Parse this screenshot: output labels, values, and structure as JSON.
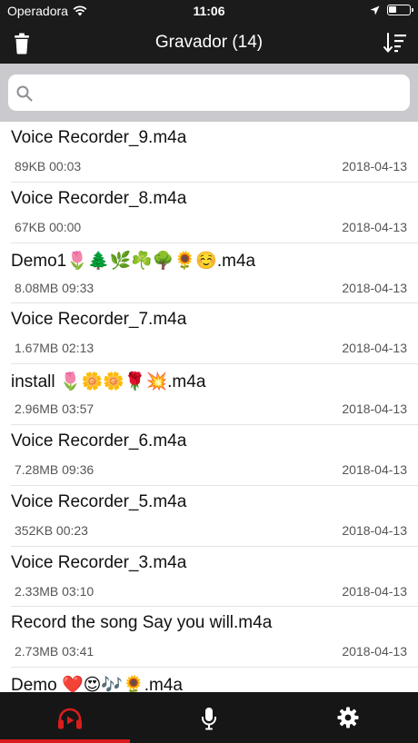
{
  "status_bar": {
    "carrier": "Operadora",
    "time": "11:06"
  },
  "nav": {
    "title": "Gravador (14)",
    "trash_icon": "trash-icon",
    "sort_icon": "sort-icon"
  },
  "search": {
    "placeholder": "",
    "value": ""
  },
  "recordings": [
    {
      "name": "Voice Recorder_9.m4a",
      "meta": "89KB 00:03",
      "date": "2018-04-13"
    },
    {
      "name": "Voice Recorder_8.m4a",
      "meta": "67KB 00:00",
      "date": "2018-04-13"
    },
    {
      "name": "Demo1🌷🌲🌿☘️🌳🌻☺️.m4a",
      "meta": "8.08MB 09:33",
      "date": "2018-04-13"
    },
    {
      "name": "Voice Recorder_7.m4a",
      "meta": "1.67MB 02:13",
      "date": "2018-04-13"
    },
    {
      "name": "install 🌷🌼🌼🌹💥.m4a",
      "meta": "2.96MB 03:57",
      "date": "2018-04-13"
    },
    {
      "name": "Voice Recorder_6.m4a",
      "meta": "7.28MB 09:36",
      "date": "2018-04-13"
    },
    {
      "name": "Voice Recorder_5.m4a",
      "meta": "352KB 00:23",
      "date": "2018-04-13"
    },
    {
      "name": "Voice Recorder_3.m4a",
      "meta": "2.33MB 03:10",
      "date": "2018-04-13"
    },
    {
      "name": "Record the song Say you will.m4a",
      "meta": "2.73MB 03:41",
      "date": "2018-04-13"
    },
    {
      "name": "Demo ❤️😍🎶🌻.m4a",
      "meta": "",
      "date": ""
    }
  ],
  "tabs": [
    {
      "icon": "headphones-play-icon",
      "active": true
    },
    {
      "icon": "microphone-icon",
      "active": false
    },
    {
      "icon": "gear-icon",
      "active": false
    }
  ],
  "colors": {
    "header_bg": "#1b1b1b",
    "accent": "#d81d1d",
    "tabbar_bg": "#161616"
  }
}
